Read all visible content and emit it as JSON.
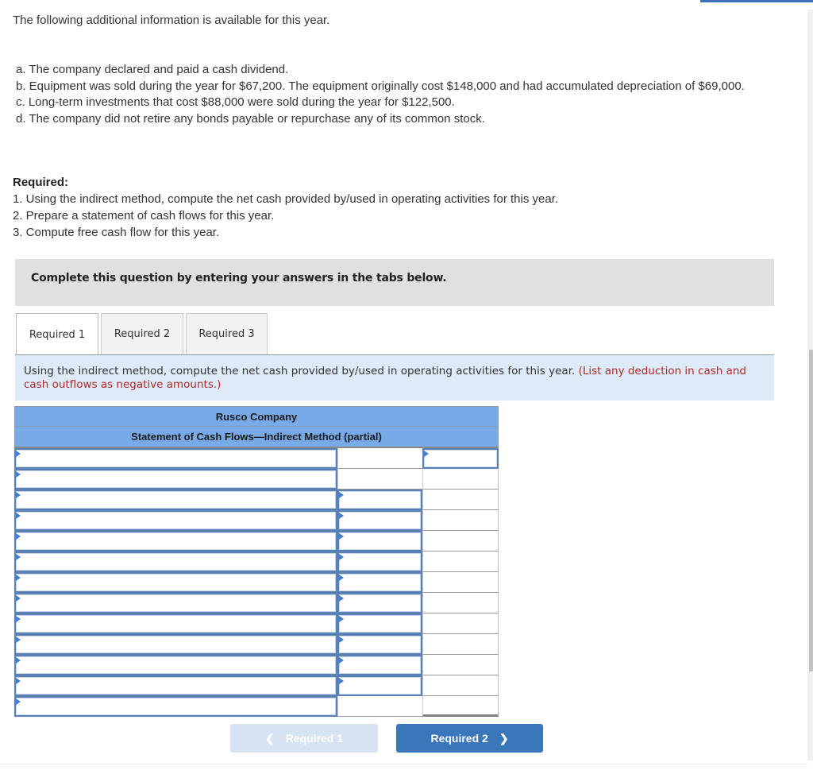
{
  "intro": "The following additional information is available for this year.",
  "info_items": [
    "a. The company declared and paid a cash dividend.",
    "b. Equipment was sold during the year for $67,200. The equipment originally cost $148,000 and had accumulated depreciation of $69,000.",
    "c. Long-term investments that cost $88,000 were sold during the year for $122,500.",
    "d. The company did not retire any bonds payable or repurchase any of its common stock."
  ],
  "required": {
    "title": "Required:",
    "items": [
      "1. Using the indirect method, compute the net cash provided by/used in operating activities for this year.",
      "2. Prepare a statement of cash flows for this year.",
      "3. Compute free cash flow for this year."
    ]
  },
  "instruction": "Complete this question by entering your answers in the tabs below.",
  "tabs": [
    {
      "label": "Required 1",
      "active": true
    },
    {
      "label": "Required 2",
      "active": false
    },
    {
      "label": "Required 3",
      "active": false
    }
  ],
  "prompt": {
    "text": "Using the indirect method, compute the net cash provided by/used in operating activities for this year.",
    "note": "(List any deduction in cash and cash outflows as negative amounts.)"
  },
  "statement": {
    "company": "Rusco Company",
    "title": "Statement of Cash Flows—Indirect Method (partial)",
    "rows": [
      {
        "label": "",
        "amount": null,
        "total": ""
      },
      {
        "label": "",
        "amount": null,
        "total": null
      },
      {
        "label": "",
        "amount": "",
        "total": null
      },
      {
        "label": "",
        "amount": "",
        "total": null
      },
      {
        "label": "",
        "amount": "",
        "total": null
      },
      {
        "label": "",
        "amount": "",
        "total": null
      },
      {
        "label": "",
        "amount": "",
        "total": null
      },
      {
        "label": "",
        "amount": "",
        "total": null
      },
      {
        "label": "",
        "amount": "",
        "total": null
      },
      {
        "label": "",
        "amount": "",
        "total": null
      },
      {
        "label": "",
        "amount": "",
        "total": null
      },
      {
        "label": "",
        "amount": "",
        "total": null
      },
      {
        "label": "",
        "amount": null,
        "total": null
      }
    ]
  },
  "navigation": {
    "prev_label": "Required 1",
    "prev_icon": "chevron-left-icon",
    "prev_enabled": false,
    "next_label": "Required 2",
    "next_icon": "chevron-right-icon",
    "next_enabled": true
  },
  "colors": {
    "accent": "#3a76ba",
    "header_blue": "#77aae6",
    "prompt_bg": "#ddeaf7",
    "note_red": "#b02a2a"
  }
}
